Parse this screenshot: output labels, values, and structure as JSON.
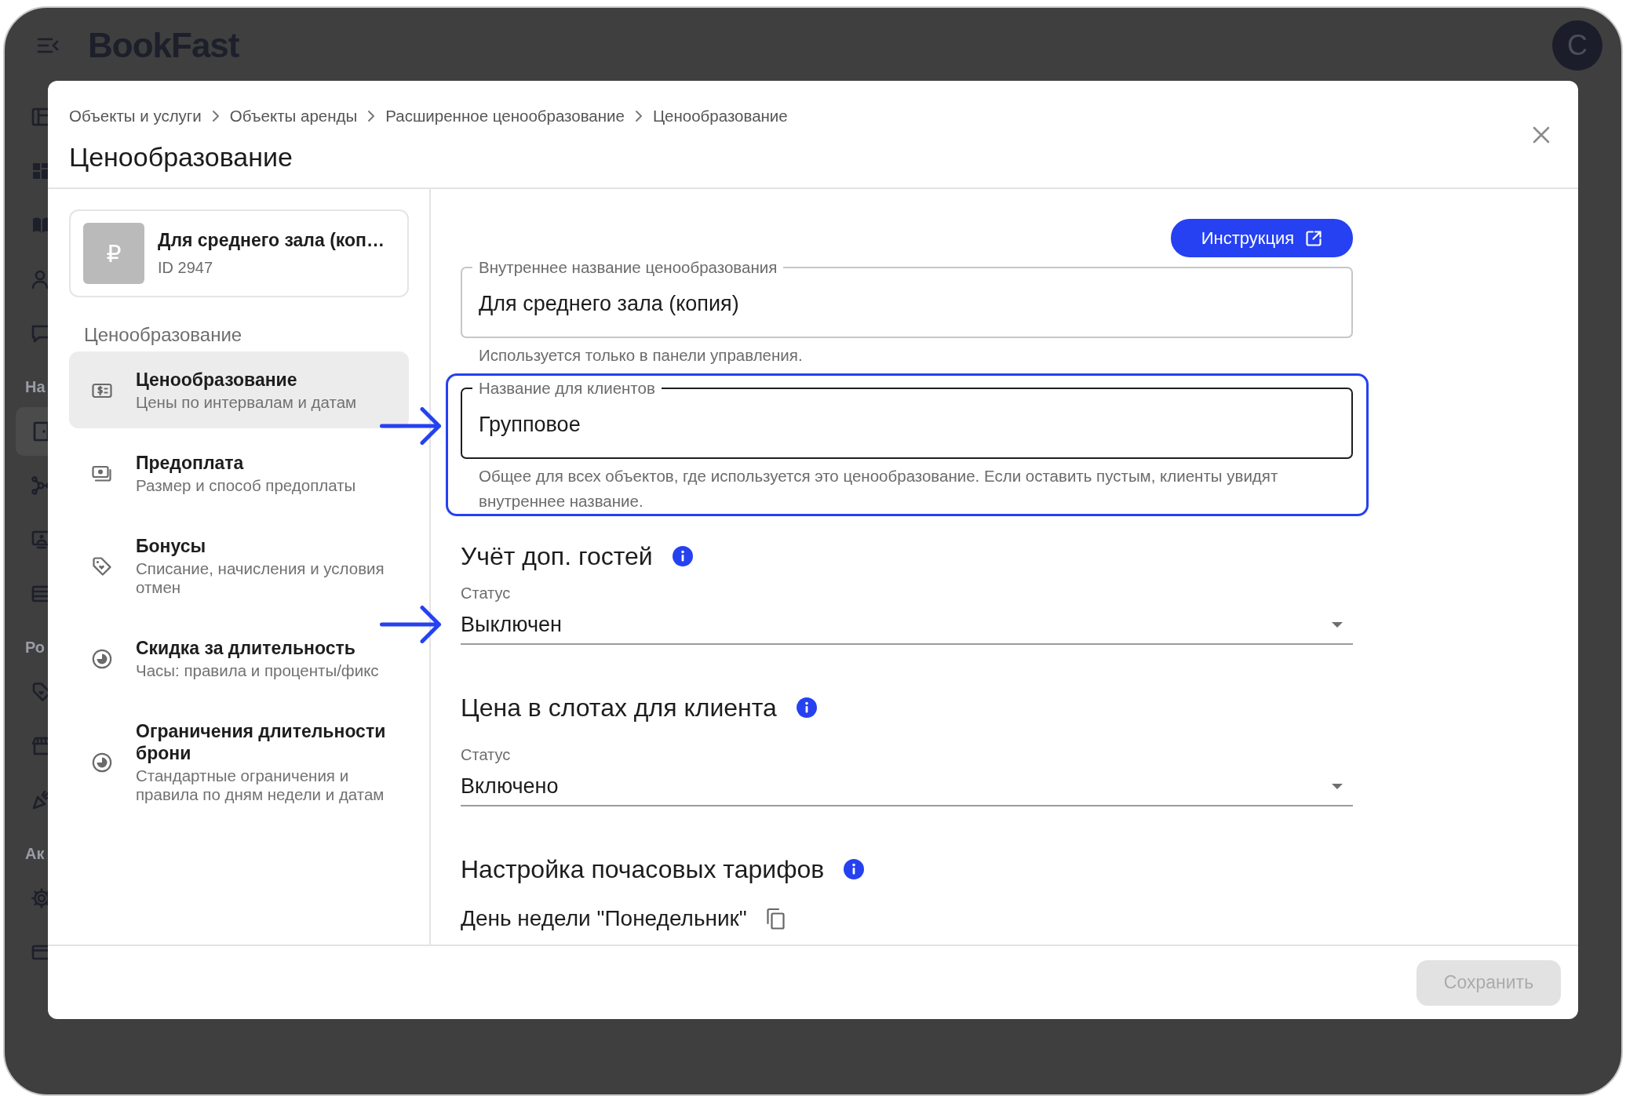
{
  "app": {
    "logo": "BookFast",
    "avatar": "С",
    "nav_groups": [
      {
        "items": [
          {
            "selected": false
          },
          {
            "selected": false
          },
          {
            "selected": false
          },
          {
            "selected": false
          },
          {
            "selected": false
          }
        ]
      },
      {
        "label": "На",
        "items": [
          {
            "selected": true
          },
          {
            "selected": false
          },
          {
            "selected": false
          },
          {
            "selected": false
          }
        ]
      },
      {
        "label": "Ро",
        "items": [
          {
            "selected": false
          },
          {
            "selected": false
          },
          {
            "selected": false
          }
        ]
      },
      {
        "label": "Ак",
        "items": [
          {
            "selected": false
          },
          {
            "selected": false
          }
        ]
      }
    ]
  },
  "modal": {
    "breadcrumbs": [
      "Объекты и услуги",
      "Объекты аренды",
      "Расширенное ценообразование",
      "Ценообразование"
    ],
    "title": "Ценообразование",
    "object_card": {
      "thumbnail": "₽",
      "title": "Для среднего зала (коп…",
      "id": "ID 2947"
    },
    "menu_heading": "Ценообразование",
    "menu": [
      {
        "title": "Ценообразование",
        "subtitle": "Цены по интервалам и датам",
        "selected": true
      },
      {
        "title": "Предоплата",
        "subtitle": "Размер и способ предоплаты",
        "selected": false
      },
      {
        "title": "Бонусы",
        "subtitle": "Списание, начисления и условия отмен",
        "selected": false
      },
      {
        "title": "Скидка за длительность",
        "subtitle": "Часы: правила и проценты/фикс",
        "selected": false
      },
      {
        "title": "Ограничения длительности брони",
        "subtitle": "Стандартные ограничения и правила по дням недели и датам",
        "selected": false
      }
    ],
    "instruction_button": "Инструкция",
    "fields": [
      {
        "label": "Внутреннее название ценообразования",
        "value": "Для среднего зала (копия)",
        "helper": "Используется только в панели управления.",
        "hovered": false,
        "highlighted": false,
        "arrow": false
      },
      {
        "label": "Название для клиентов",
        "value": "Групповое",
        "helper": "Общее для всех объектов, где используется это ценообразование. Если оставить пустым, клиенты увидят внутреннее название.",
        "hovered": true,
        "highlighted": true,
        "arrow": true
      }
    ],
    "sections": [
      {
        "kind": "select",
        "title": "Учёт доп. гостей",
        "field_label": "Статус",
        "value": "Выключен",
        "arrow": true
      },
      {
        "kind": "select",
        "title": "Цена в слотах для клиента",
        "field_label": "Статус",
        "value": "Включено",
        "arrow": false
      },
      {
        "kind": "tariffs",
        "title": "Настройка почасовых тарифов",
        "day": "День недели \"Понедельник\""
      }
    ],
    "save_button": {
      "label": "Сохранить",
      "disabled": true
    }
  }
}
